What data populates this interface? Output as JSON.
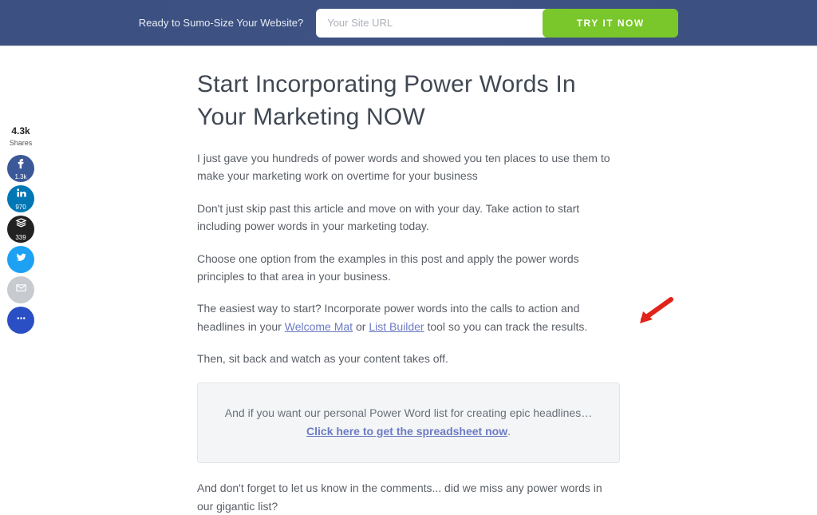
{
  "topbar": {
    "prompt": "Ready to Sumo-Size Your Website?",
    "url_placeholder": "Your Site URL",
    "cta_label": "TRY IT NOW"
  },
  "share": {
    "total": "4.3k",
    "total_label": "Shares",
    "facebook_count": "1.3k",
    "linkedin_count": "970",
    "buffer_count": "339"
  },
  "article": {
    "heading": "Start Incorporating Power Words In Your Marketing NOW",
    "p1": "I just gave you hundreds of power words and showed you ten places to use them to make your marketing work on overtime for your business",
    "p2": "Don't just skip past this article and move on with your day. Take action to start including power words in your marketing today.",
    "p3": "Choose one option from the examples in this post and apply the power words principles to that area in your business.",
    "p4a": "The easiest way to start? Incorporate power words into the calls to action and headlines in your ",
    "link_welcome": "Welcome Mat",
    "p4b": " or ",
    "link_listbuilder": "List Builder",
    "p4c": " tool so you can track the results.",
    "p5": "Then, sit back and watch as your content takes off.",
    "callout_lead": "And if you want our personal Power Word list for creating epic headlines…",
    "callout_link": "Click here to get the spreadsheet now",
    "p6": "And don't forget to let us know in the comments... did we miss any power words in our gigantic list?"
  }
}
